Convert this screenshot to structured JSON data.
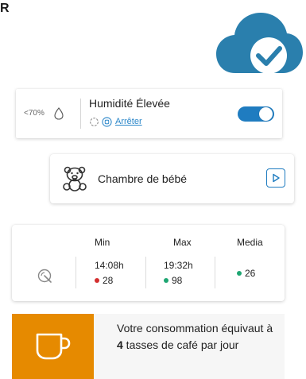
{
  "corner_letter": "R",
  "logo": {
    "name": "cloud-check-logo",
    "color": "#2a7fad"
  },
  "humidity": {
    "threshold": "<70%",
    "title": "Humidité Élevée",
    "stop_label": "Arrêter",
    "toggle_on": true,
    "accent": "#1f7cc0"
  },
  "room": {
    "name": "Chambre de bébé",
    "icon": "teddy-bear-icon"
  },
  "stats": {
    "columns": [
      {
        "header": "Min",
        "time": "14:08h",
        "value": "28",
        "status_color": "#d32f2f"
      },
      {
        "header": "Max",
        "time": "19:32h",
        "value": "98",
        "status_color": "#1ea672"
      },
      {
        "header": "Media",
        "time": "",
        "value": "26",
        "status_color": "#1ea672"
      }
    ]
  },
  "coffee": {
    "text_before": "Votre consommation équivaut à ",
    "cups": "4",
    "text_after": " tasses de café par jour",
    "tile_color": "#e68a00"
  }
}
